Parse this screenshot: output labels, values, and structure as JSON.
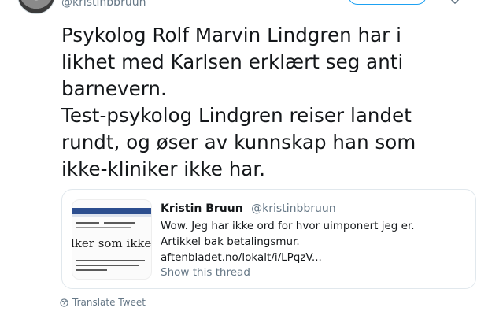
{
  "author": {
    "handle": "@kristinbbruun",
    "avatar_icon": "avatar-photo"
  },
  "tweet": {
    "lines": [
      "Psykolog Rolf Marvin Lindgren har i",
      "likhet med Karlsen erklært seg anti",
      "barnevern.",
      "Test-psykolog Lindgren reiser landet",
      "rundt, og øser av kunnskap han som",
      "ikke-kliniker ikke har."
    ]
  },
  "quoted_tweet": {
    "name": "Kristin Bruun",
    "handle": "@kristinbbruun",
    "body_lines": [
      "Wow. Jeg har ikke ord for hvor uimponert jeg er.",
      "Artikkel bak betalingsmur.",
      "aftenbladet.no/lokalt/i/LPqzV..."
    ],
    "thread_link": "Show this thread",
    "thumbnail": {
      "headline": "lker som ikke skj",
      "icon": "article-thumbnail"
    }
  },
  "translate_label": "Translate Tweet",
  "colors": {
    "accent": "#1da1f2",
    "secondary_text": "#657786",
    "border": "#e1e8ed"
  }
}
